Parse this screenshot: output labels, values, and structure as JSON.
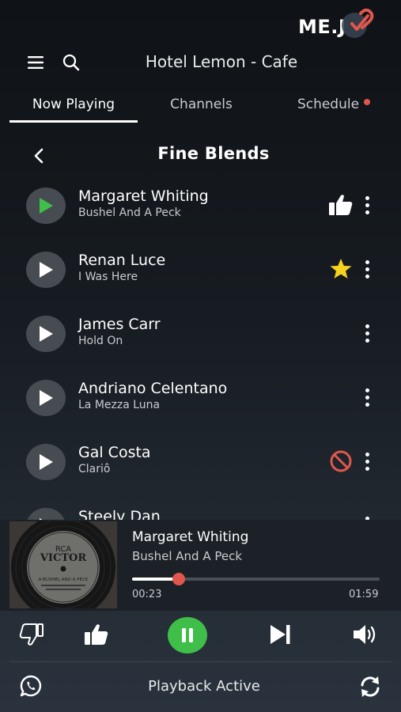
{
  "brand": {
    "logo_text": "ME.J"
  },
  "header": {
    "title": "Hotel Lemon - Cafe"
  },
  "tabs": [
    {
      "label": "Now Playing",
      "active": true
    },
    {
      "label": "Channels",
      "active": false
    },
    {
      "label": "Schedule",
      "active": false,
      "badge": true
    }
  ],
  "section": {
    "title": "Fine Blends"
  },
  "tracks": [
    {
      "artist": "Margaret Whiting",
      "song": "Bushel And A Peck",
      "playing": true,
      "status": "thumbs-up-icon"
    },
    {
      "artist": "Renan Luce",
      "song": "I Was Here",
      "playing": false,
      "status": "star-icon"
    },
    {
      "artist": "James Carr",
      "song": "Hold On",
      "playing": false,
      "status": ""
    },
    {
      "artist": "Andriano Celentano",
      "song": "La Mezza Luna",
      "playing": false,
      "status": ""
    },
    {
      "artist": "Gal Costa",
      "song": "Clariô",
      "playing": false,
      "status": "blocked-icon"
    },
    {
      "artist": "Steely Dan",
      "song": "",
      "playing": false,
      "status": ""
    }
  ],
  "now_playing": {
    "artist": "Margaret Whiting",
    "song": "Bushel And A Peck",
    "elapsed": "00:23",
    "duration": "01:59",
    "progress": 0.19,
    "album_art": {
      "label_top": "RCA",
      "label_brand": "VICTOR",
      "label_title": "A-BUSHEL AND A PECK"
    }
  },
  "controls": [
    "thumbs-down-icon",
    "thumbs-up-icon",
    "pause-icon",
    "skip-next-icon",
    "volume-icon"
  ],
  "footer": {
    "status": "Playback Active"
  },
  "colors": {
    "accent_green": "#3fbf4a",
    "accent_red": "#e0574e",
    "star_yellow": "#f4d21f"
  }
}
